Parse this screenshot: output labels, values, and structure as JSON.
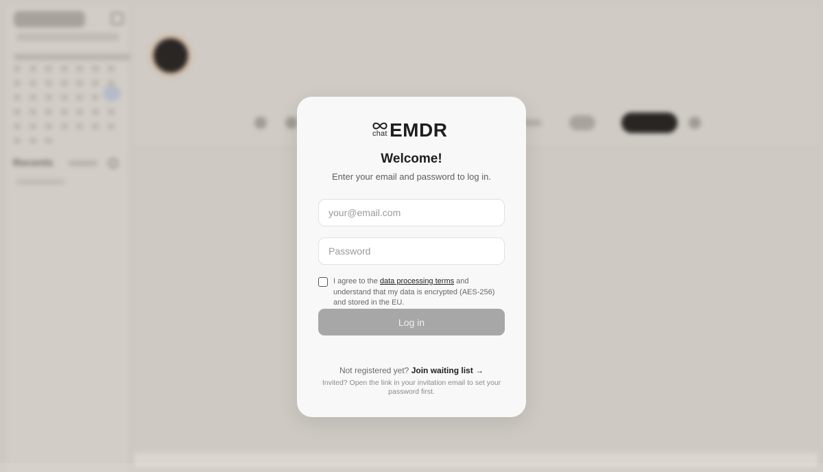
{
  "background": {
    "recents_label": "Recents"
  },
  "login": {
    "logo_prefix": "chat",
    "logo_name": "EMDR",
    "title": "Welcome!",
    "subtitle": "Enter your email and password to log in.",
    "email_placeholder": "your@email.com",
    "password_placeholder": "Password",
    "consent_prefix": "I agree to the ",
    "consent_link": "data processing terms",
    "consent_suffix": " and understand that my data is encrypted (AES-256) and stored in the EU.",
    "login_button": "Log in",
    "register_prompt": "Not registered yet?",
    "register_link": "Join waiting list →",
    "invited_note": "Invited? Open the link in your invitation email to set your password first.",
    "consent_checked": false
  },
  "colors": {
    "disabled_button": "#a7a7a7",
    "modal_bg": "#f8f8f8",
    "backdrop": "#d3cfc8"
  }
}
